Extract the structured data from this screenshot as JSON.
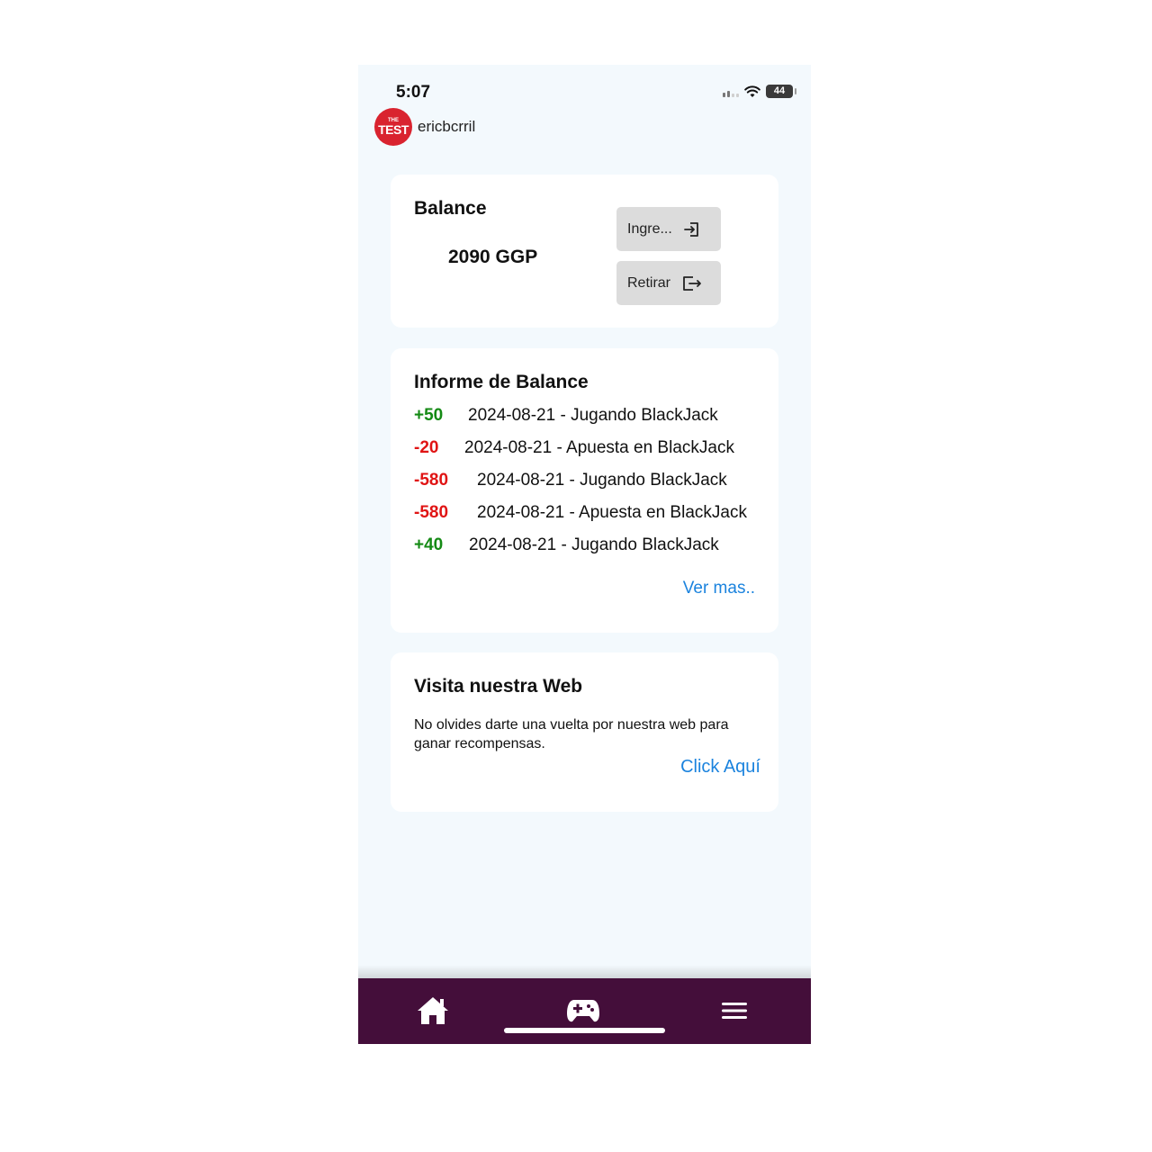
{
  "status_bar": {
    "time": "5:07",
    "battery": "44",
    "battery_level": 0.44
  },
  "header": {
    "logo_small": "THE",
    "logo_big": "TEST",
    "username": "ericbcrril"
  },
  "balance": {
    "title": "Balance",
    "amount": "2090 GGP",
    "deposit_label": "Ingre...",
    "withdraw_label": "Retirar"
  },
  "report": {
    "title": "Informe de Balance",
    "entries": [
      {
        "amount": "+50",
        "type": "positive",
        "description": "2024-08-21 - Jugando BlackJack"
      },
      {
        "amount": "-20",
        "type": "negative",
        "description": "2024-08-21 - Apuesta en BlackJack"
      },
      {
        "amount": "-580",
        "type": "negative",
        "description": "2024-08-21 - Jugando BlackJack"
      },
      {
        "amount": "-580",
        "type": "negative",
        "description": "2024-08-21 - Apuesta en BlackJack"
      },
      {
        "amount": "+40",
        "type": "positive",
        "description": "2024-08-21 - Jugando BlackJack"
      }
    ],
    "see_more": "Ver mas.."
  },
  "web": {
    "title": "Visita nuestra Web",
    "text": "No olvides darte una vuelta por nuestra web para ganar recompensas.",
    "link": "Click Aquí"
  },
  "colors": {
    "background": "#f3f9fd",
    "nav": "#440e3a",
    "positive": "#148a14",
    "negative": "#e01414",
    "link": "#1b83de",
    "logo": "#d9232f"
  },
  "nav": {
    "items": [
      "home-icon",
      "gamepad-icon",
      "menu-icon"
    ],
    "active": "gamepad-icon"
  }
}
